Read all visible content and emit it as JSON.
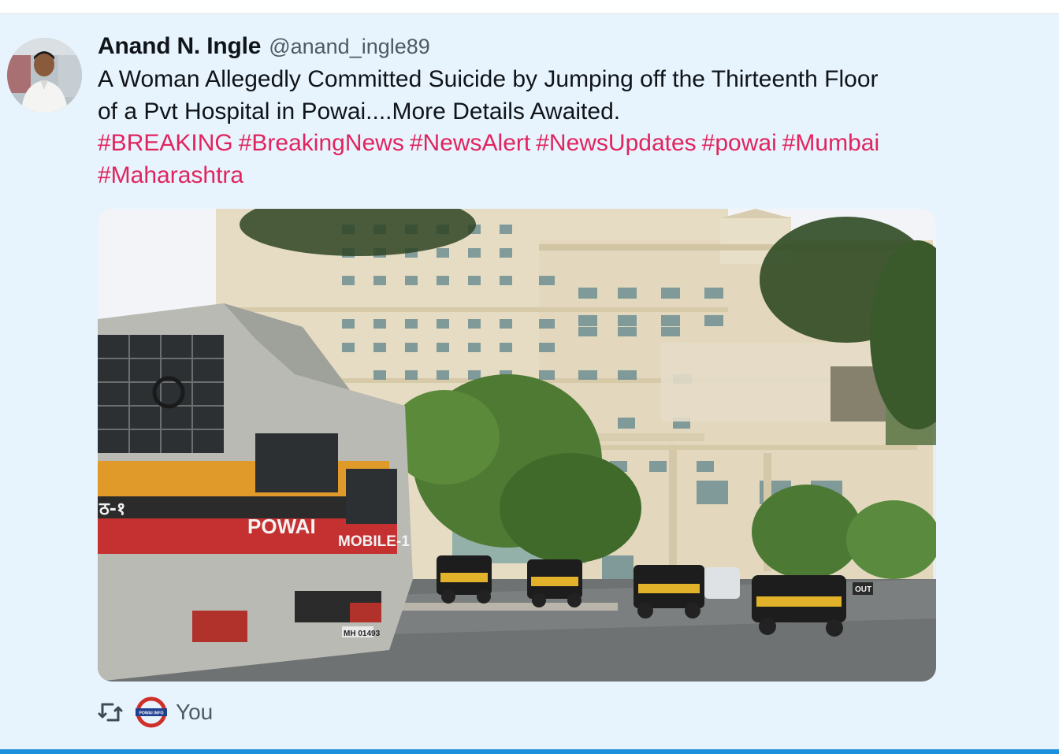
{
  "tweet": {
    "author_name": "Anand N. Ingle",
    "author_handle": "@anand_ingle89",
    "text_lines": [
      "A Woman Allegedly Committed Suicide by Jumping off the Thirteenth Floor",
      "of a Pvt Hospital in Powai....More Details Awaited."
    ],
    "hashtag_lines": [
      [
        "#BREAKING",
        "#BreakingNews",
        "#NewsAlert",
        "#NewsUpdates",
        "#powai",
        "#Mumbai"
      ],
      [
        "#Maharashtra"
      ]
    ],
    "media": {
      "van_text_1": "POWAI",
      "van_text_2": "MOBILE-1",
      "van_side_text": "ठ-१",
      "sign_text": "OUT",
      "plate_text": "MH 01493"
    }
  },
  "footer": {
    "retweet_icon": "retweet-icon",
    "channel_logo_text": "POWAI INFO",
    "retweeted_by": "You"
  },
  "colors": {
    "background": "#e8f4fd",
    "hashtag": "#e0245e",
    "text": "#0f1419",
    "secondary": "#4d5a66",
    "accent_bar": "#1d8fdb"
  }
}
